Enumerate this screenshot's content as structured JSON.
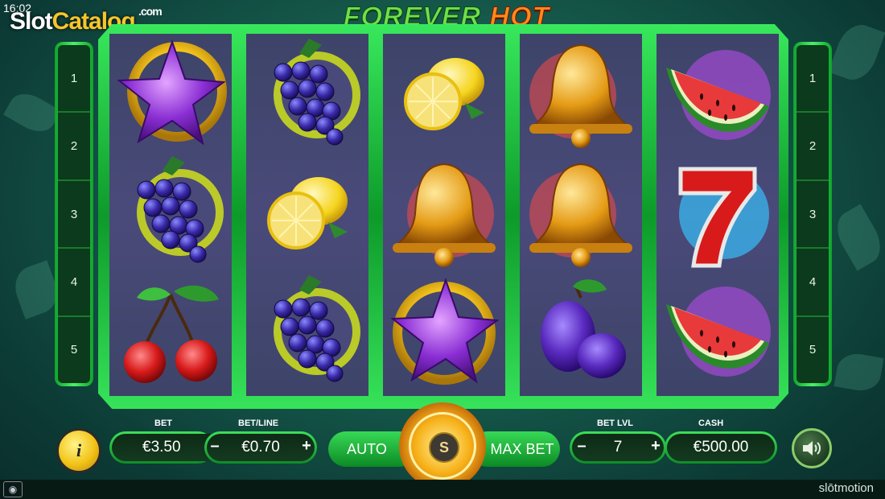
{
  "status": {
    "time": "16:02"
  },
  "watermark": {
    "slot": "Slot",
    "catalog": "Catalog",
    "com": ".com"
  },
  "game": {
    "title_part1": "FOREVER",
    "title_part2": "HOT"
  },
  "paylines": {
    "left": [
      "1",
      "2",
      "3",
      "4",
      "5"
    ],
    "right": [
      "1",
      "2",
      "3",
      "4",
      "5"
    ]
  },
  "reels": [
    [
      "star",
      "grapes",
      "cherries"
    ],
    [
      "grapes",
      "lemon",
      "grapes"
    ],
    [
      "lemon",
      "bell",
      "star"
    ],
    [
      "bell",
      "bell",
      "plum"
    ],
    [
      "watermelon",
      "seven",
      "watermelon"
    ]
  ],
  "controls": {
    "bet_label": "BET",
    "bet_value": "€3.50",
    "bet_line_label": "BET/LINE",
    "bet_line_value": "€0.70",
    "minus": "–",
    "plus": "+",
    "auto_label": "AUTO",
    "spin_label": "S",
    "max_bet_label": "MAX BET",
    "bet_lvl_label": "BET LVL",
    "bet_lvl_value": "7",
    "cash_label": "CASH",
    "cash_value": "€500.00",
    "info_label": "i"
  },
  "brand": "slōtmotion",
  "colors": {
    "accent_green": "#3ee05a",
    "gold": "#f2c418",
    "reel_bg": "#4a4a7a"
  }
}
